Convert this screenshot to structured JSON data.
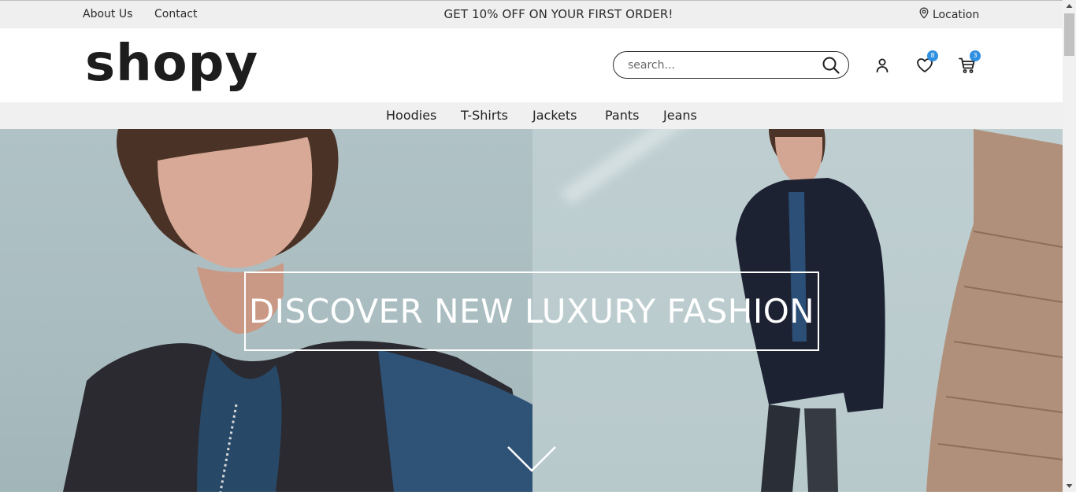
{
  "topbar": {
    "links": [
      "About Us",
      "Contact"
    ],
    "promo": "GET 10% OFF ON YOUR FIRST ORDER!",
    "location_label": "Location"
  },
  "header": {
    "logo": "shopy",
    "search": {
      "placeholder": "search...",
      "value": ""
    },
    "wishlist_count": "8",
    "cart_count": "3"
  },
  "categories": [
    "Hoodies",
    "T-Shirts",
    "Jackets",
    "Pants",
    "Jeans"
  ],
  "hero": {
    "title": "DISCOVER NEW LUXURY FASHION"
  },
  "colors": {
    "accent": "#2f8fe0",
    "topbar_bg": "#efefef",
    "text": "#1d1d1d"
  },
  "icons": [
    "location-pin-icon",
    "search-icon",
    "user-icon",
    "heart-icon",
    "cart-icon",
    "chevron-down-icon"
  ]
}
